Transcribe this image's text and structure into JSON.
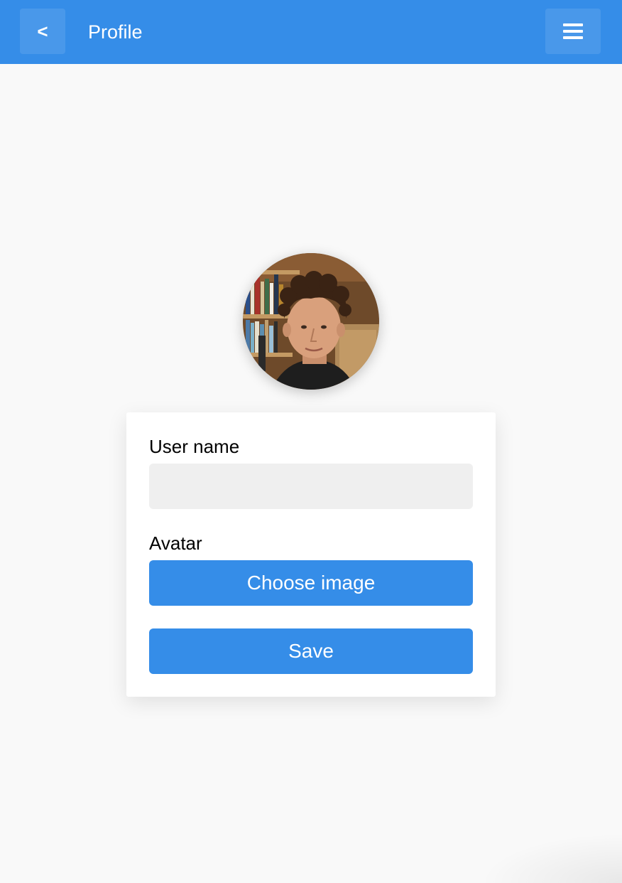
{
  "header": {
    "back_label": "<",
    "title": "Profile",
    "menu_icon": "hamburger-menu-icon"
  },
  "profile": {
    "avatar_alt": "profile-photo"
  },
  "form": {
    "username_label": "User name",
    "username_value": "",
    "avatar_label": "Avatar",
    "choose_image_label": "Choose image",
    "save_label": "Save"
  },
  "colors": {
    "accent": "#358de8",
    "background": "#f9f9f9",
    "input_background": "#efefef",
    "card_background": "#ffffff"
  }
}
